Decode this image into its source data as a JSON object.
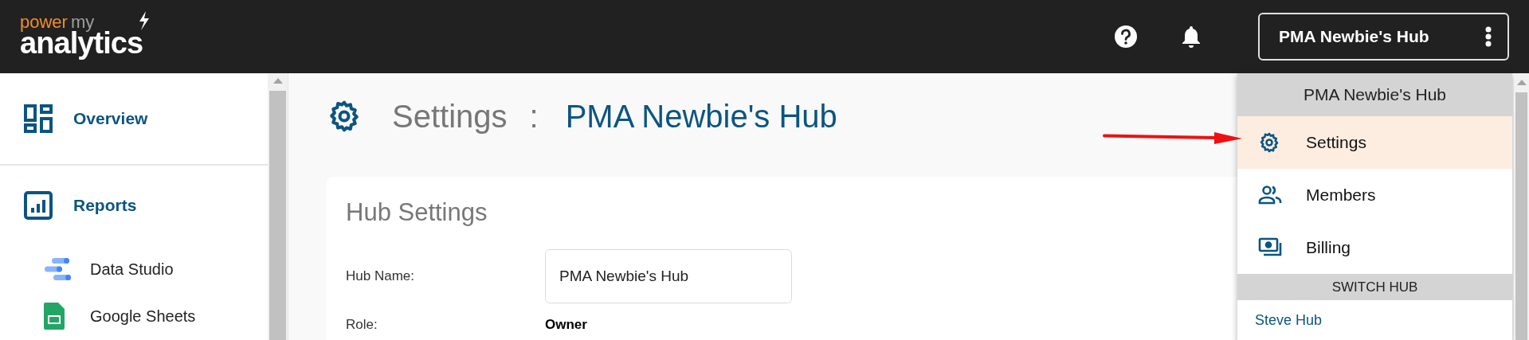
{
  "header": {
    "logo": {
      "word_1": "power",
      "word_2": "my",
      "word_3": "analytics"
    },
    "hub_button": {
      "label": "PMA Newbie's Hub"
    }
  },
  "sidebar": {
    "items": [
      {
        "label": "Overview",
        "kind": "section"
      },
      {
        "label": "Reports",
        "kind": "section"
      },
      {
        "label": "Data Studio",
        "kind": "sub"
      },
      {
        "label": "Google Sheets",
        "kind": "sub"
      }
    ]
  },
  "page": {
    "title": "Settings",
    "separator": ":",
    "hub_name": "PMA Newbie's Hub"
  },
  "card": {
    "heading": "Hub Settings",
    "fields": [
      {
        "label": "Hub Name:",
        "kind": "input",
        "value": "PMA Newbie's Hub"
      },
      {
        "label": "Role:",
        "kind": "text",
        "value": "Owner"
      }
    ]
  },
  "menu": {
    "title": "PMA Newbie's Hub",
    "items": [
      {
        "label": "Settings",
        "selected": true
      },
      {
        "label": "Members",
        "selected": false
      },
      {
        "label": "Billing",
        "selected": false
      }
    ],
    "switch_heading": "SWITCH HUB",
    "hubs": [
      "Steve Hub"
    ]
  }
}
